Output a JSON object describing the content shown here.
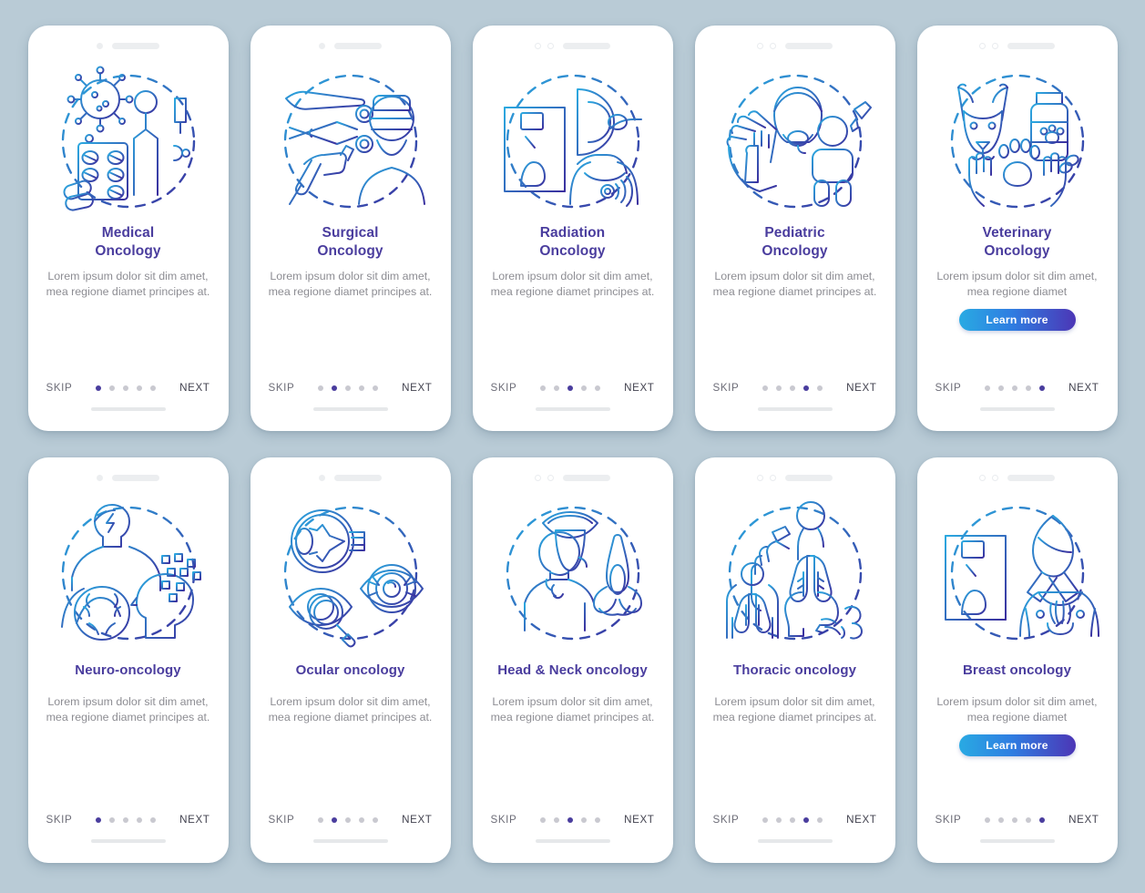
{
  "theme": {
    "background": "#b9cbd6",
    "card_background": "#ffffff",
    "title_color": "#4a3d9e",
    "body_color": "#8d8d93",
    "dot_active_color": "#4a3d9e",
    "dot_inactive_color": "#c9c9d0",
    "button_gradient_from": "#29aae3",
    "button_gradient_to": "#4c36b6",
    "illustration_gradient_from": "#2ba9e0",
    "illustration_gradient_to": "#3b2f9e"
  },
  "common": {
    "skip_label": "SKIP",
    "next_label": "NEXT",
    "learn_more_label": "Learn more",
    "description": "Lorem ipsum dolor sit dim amet, mea regione diamet principes at.",
    "description_short": "Lorem ipsum dolor sit dim amet, mea regione diamet",
    "total_dots": 5
  },
  "screens": [
    {
      "id": "medical-oncology",
      "title_line1": "Medical",
      "title_line2": "Oncology",
      "title": "Medical Oncology",
      "description": "Lorem ipsum dolor sit dim amet, mea regione diamet principes at.",
      "active_dot": 1,
      "has_learn_more": false,
      "notch_dots": 1,
      "icon": "virus-pills-patient-icon"
    },
    {
      "id": "surgical-oncology",
      "title_line1": "Surgical",
      "title_line2": "Oncology",
      "title": "Surgical Oncology",
      "description": "Lorem ipsum dolor sit dim amet, mea regione diamet principes at.",
      "active_dot": 2,
      "has_learn_more": false,
      "notch_dots": 1,
      "icon": "scalpel-surgeon-icon"
    },
    {
      "id": "radiation-oncology",
      "title_line1": "Radiation",
      "title_line2": "Oncology",
      "title": "Radiation Oncology",
      "description": "Lorem ipsum dolor sit dim amet, mea regione diamet principes at.",
      "active_dot": 3,
      "has_learn_more": false,
      "notch_dots": 2,
      "icon": "xray-mri-torso-icon"
    },
    {
      "id": "pediatric-oncology",
      "title_line1": "Pediatric",
      "title_line2": "Oncology",
      "title": "Pediatric Oncology",
      "description": "Lorem ipsum dolor sit dim amet, mea regione diamet principes at.",
      "active_dot": 4,
      "has_learn_more": false,
      "notch_dots": 2,
      "icon": "child-hands-icon"
    },
    {
      "id": "veterinary-oncology",
      "title_line1": "Veterinary",
      "title_line2": "Oncology",
      "title": "Veterinary Oncology",
      "description": "Lorem ipsum dolor sit dim amet, mea regione diamet",
      "active_dot": 5,
      "has_learn_more": true,
      "notch_dots": 2,
      "icon": "dog-paw-pills-icon"
    },
    {
      "id": "neuro-oncology",
      "title_line1": "Neuro-oncology",
      "title_line2": "",
      "title": "Neuro-oncology",
      "description": "Lorem ipsum dolor sit dim amet, mea regione diamet principes at.",
      "active_dot": 1,
      "has_learn_more": false,
      "notch_dots": 1,
      "icon": "brain-head-icon"
    },
    {
      "id": "ocular-oncology",
      "title_line1": "Ocular oncology",
      "title_line2": "",
      "title": "Ocular oncology",
      "description": "Lorem ipsum dolor sit dim amet, mea regione diamet principes at.",
      "active_dot": 2,
      "has_learn_more": false,
      "notch_dots": 1,
      "icon": "eyeball-magnifier-icon"
    },
    {
      "id": "head-neck-oncology",
      "title_line1": "Head & Neck oncology",
      "title_line2": "",
      "title": "Head & Neck oncology",
      "description": "Lorem ipsum dolor sit dim amet, mea regione diamet principes at.",
      "active_dot": 3,
      "has_learn_more": false,
      "notch_dots": 2,
      "icon": "mouth-nose-throat-icon"
    },
    {
      "id": "thoracic-oncology",
      "title_line1": "Thoracic oncology",
      "title_line2": "",
      "title": "Thoracic oncology",
      "description": "Lorem ipsum dolor sit dim amet, mea regione diamet principes at.",
      "active_dot": 4,
      "has_learn_more": false,
      "notch_dots": 2,
      "icon": "lungs-cough-icon"
    },
    {
      "id": "breast-oncology",
      "title_line1": "Breast oncology",
      "title_line2": "",
      "title": "Breast oncology",
      "description": "Lorem ipsum dolor sit dim amet, mea regione diamet",
      "active_dot": 5,
      "has_learn_more": true,
      "notch_dots": 2,
      "icon": "mammogram-ribbon-icon"
    }
  ]
}
